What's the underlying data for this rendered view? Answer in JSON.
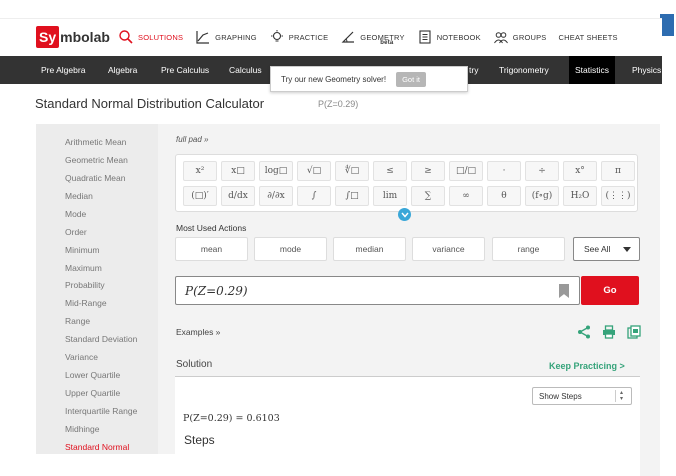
{
  "brand": {
    "logo_sy": "Sy",
    "logo_rest": "mbolab"
  },
  "topnav": [
    {
      "label": "SOLUTIONS",
      "icon": "search-icon"
    },
    {
      "label": "GRAPHING",
      "icon": "graph-icon"
    },
    {
      "label": "PRACTICE",
      "icon": "lightbulb-icon"
    },
    {
      "label": "GEOMETRY",
      "icon": "angle-icon",
      "badge": "beta"
    },
    {
      "label": "NOTEBOOK",
      "icon": "notebook-icon"
    },
    {
      "label": "GROUPS",
      "icon": "groups-icon"
    },
    {
      "label": "CHEAT SHEETS",
      "icon": ""
    }
  ],
  "subjects": [
    "Pre Algebra",
    "Algebra",
    "Pre Calculus",
    "Calculus",
    "try",
    "Trigonometry",
    "Statistics",
    "Physics"
  ],
  "tooltip": {
    "text": "Try our new Geometry solver!",
    "button": "Got it"
  },
  "page": {
    "title": "Standard Normal Distribution Calculator",
    "subtitle": "P(Z=0.29)"
  },
  "sidebar": [
    "Arithmetic Mean",
    "Geometric Mean",
    "Quadratic Mean",
    "Median",
    "Mode",
    "Order",
    "Minimum",
    "Maximum",
    "Probability",
    "Mid-Range",
    "Range",
    "Standard Deviation",
    "Variance",
    "Lower Quartile",
    "Upper Quartile",
    "Interquartile Range",
    "Midhinge",
    "Standard Normal"
  ],
  "fullpad": "full pad »",
  "keypad": {
    "row1": [
      "x²",
      "x□",
      "log□",
      "√□",
      "∜□",
      "≤",
      "≥",
      "□/□",
      "·",
      "÷",
      "x°",
      "π"
    ],
    "row2": [
      "(□)′",
      "d/dx",
      "∂/∂x",
      "∫",
      "∫□",
      "lim",
      "∑",
      "∞",
      "θ",
      "(f∘g)",
      "H₂O",
      "(⋮⋮)"
    ]
  },
  "most_used": {
    "title": "Most Used Actions",
    "actions": [
      "mean",
      "mode",
      "median",
      "variance",
      "range"
    ],
    "see_all": "See All"
  },
  "input": {
    "value": "P(Z=0.29)"
  },
  "go_label": "Go",
  "examples_label": "Examples »",
  "solution": {
    "label": "Solution",
    "keep_practicing": "Keep Practicing >",
    "show_steps": "Show Steps",
    "result": "P(Z=0.29) = 0.6103",
    "steps_label": "Steps"
  },
  "colors": {
    "brand_red": "#e0101e",
    "accent_green": "#35a37a",
    "accent_blue": "#3aa7d8"
  }
}
